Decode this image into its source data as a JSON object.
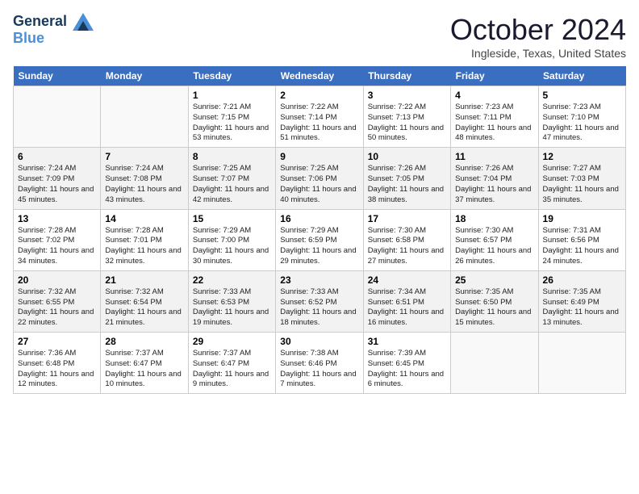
{
  "header": {
    "logo_line1": "General",
    "logo_line2": "Blue",
    "month": "October 2024",
    "location": "Ingleside, Texas, United States"
  },
  "days": [
    "Sunday",
    "Monday",
    "Tuesday",
    "Wednesday",
    "Thursday",
    "Friday",
    "Saturday"
  ],
  "weeks": [
    [
      {
        "date": "",
        "sunrise": "",
        "sunset": "",
        "daylight": ""
      },
      {
        "date": "",
        "sunrise": "",
        "sunset": "",
        "daylight": ""
      },
      {
        "date": "1",
        "sunrise": "Sunrise: 7:21 AM",
        "sunset": "Sunset: 7:15 PM",
        "daylight": "Daylight: 11 hours and 53 minutes."
      },
      {
        "date": "2",
        "sunrise": "Sunrise: 7:22 AM",
        "sunset": "Sunset: 7:14 PM",
        "daylight": "Daylight: 11 hours and 51 minutes."
      },
      {
        "date": "3",
        "sunrise": "Sunrise: 7:22 AM",
        "sunset": "Sunset: 7:13 PM",
        "daylight": "Daylight: 11 hours and 50 minutes."
      },
      {
        "date": "4",
        "sunrise": "Sunrise: 7:23 AM",
        "sunset": "Sunset: 7:11 PM",
        "daylight": "Daylight: 11 hours and 48 minutes."
      },
      {
        "date": "5",
        "sunrise": "Sunrise: 7:23 AM",
        "sunset": "Sunset: 7:10 PM",
        "daylight": "Daylight: 11 hours and 47 minutes."
      }
    ],
    [
      {
        "date": "6",
        "sunrise": "Sunrise: 7:24 AM",
        "sunset": "Sunset: 7:09 PM",
        "daylight": "Daylight: 11 hours and 45 minutes."
      },
      {
        "date": "7",
        "sunrise": "Sunrise: 7:24 AM",
        "sunset": "Sunset: 7:08 PM",
        "daylight": "Daylight: 11 hours and 43 minutes."
      },
      {
        "date": "8",
        "sunrise": "Sunrise: 7:25 AM",
        "sunset": "Sunset: 7:07 PM",
        "daylight": "Daylight: 11 hours and 42 minutes."
      },
      {
        "date": "9",
        "sunrise": "Sunrise: 7:25 AM",
        "sunset": "Sunset: 7:06 PM",
        "daylight": "Daylight: 11 hours and 40 minutes."
      },
      {
        "date": "10",
        "sunrise": "Sunrise: 7:26 AM",
        "sunset": "Sunset: 7:05 PM",
        "daylight": "Daylight: 11 hours and 38 minutes."
      },
      {
        "date": "11",
        "sunrise": "Sunrise: 7:26 AM",
        "sunset": "Sunset: 7:04 PM",
        "daylight": "Daylight: 11 hours and 37 minutes."
      },
      {
        "date": "12",
        "sunrise": "Sunrise: 7:27 AM",
        "sunset": "Sunset: 7:03 PM",
        "daylight": "Daylight: 11 hours and 35 minutes."
      }
    ],
    [
      {
        "date": "13",
        "sunrise": "Sunrise: 7:28 AM",
        "sunset": "Sunset: 7:02 PM",
        "daylight": "Daylight: 11 hours and 34 minutes."
      },
      {
        "date": "14",
        "sunrise": "Sunrise: 7:28 AM",
        "sunset": "Sunset: 7:01 PM",
        "daylight": "Daylight: 11 hours and 32 minutes."
      },
      {
        "date": "15",
        "sunrise": "Sunrise: 7:29 AM",
        "sunset": "Sunset: 7:00 PM",
        "daylight": "Daylight: 11 hours and 30 minutes."
      },
      {
        "date": "16",
        "sunrise": "Sunrise: 7:29 AM",
        "sunset": "Sunset: 6:59 PM",
        "daylight": "Daylight: 11 hours and 29 minutes."
      },
      {
        "date": "17",
        "sunrise": "Sunrise: 7:30 AM",
        "sunset": "Sunset: 6:58 PM",
        "daylight": "Daylight: 11 hours and 27 minutes."
      },
      {
        "date": "18",
        "sunrise": "Sunrise: 7:30 AM",
        "sunset": "Sunset: 6:57 PM",
        "daylight": "Daylight: 11 hours and 26 minutes."
      },
      {
        "date": "19",
        "sunrise": "Sunrise: 7:31 AM",
        "sunset": "Sunset: 6:56 PM",
        "daylight": "Daylight: 11 hours and 24 minutes."
      }
    ],
    [
      {
        "date": "20",
        "sunrise": "Sunrise: 7:32 AM",
        "sunset": "Sunset: 6:55 PM",
        "daylight": "Daylight: 11 hours and 22 minutes."
      },
      {
        "date": "21",
        "sunrise": "Sunrise: 7:32 AM",
        "sunset": "Sunset: 6:54 PM",
        "daylight": "Daylight: 11 hours and 21 minutes."
      },
      {
        "date": "22",
        "sunrise": "Sunrise: 7:33 AM",
        "sunset": "Sunset: 6:53 PM",
        "daylight": "Daylight: 11 hours and 19 minutes."
      },
      {
        "date": "23",
        "sunrise": "Sunrise: 7:33 AM",
        "sunset": "Sunset: 6:52 PM",
        "daylight": "Daylight: 11 hours and 18 minutes."
      },
      {
        "date": "24",
        "sunrise": "Sunrise: 7:34 AM",
        "sunset": "Sunset: 6:51 PM",
        "daylight": "Daylight: 11 hours and 16 minutes."
      },
      {
        "date": "25",
        "sunrise": "Sunrise: 7:35 AM",
        "sunset": "Sunset: 6:50 PM",
        "daylight": "Daylight: 11 hours and 15 minutes."
      },
      {
        "date": "26",
        "sunrise": "Sunrise: 7:35 AM",
        "sunset": "Sunset: 6:49 PM",
        "daylight": "Daylight: 11 hours and 13 minutes."
      }
    ],
    [
      {
        "date": "27",
        "sunrise": "Sunrise: 7:36 AM",
        "sunset": "Sunset: 6:48 PM",
        "daylight": "Daylight: 11 hours and 12 minutes."
      },
      {
        "date": "28",
        "sunrise": "Sunrise: 7:37 AM",
        "sunset": "Sunset: 6:47 PM",
        "daylight": "Daylight: 11 hours and 10 minutes."
      },
      {
        "date": "29",
        "sunrise": "Sunrise: 7:37 AM",
        "sunset": "Sunset: 6:47 PM",
        "daylight": "Daylight: 11 hours and 9 minutes."
      },
      {
        "date": "30",
        "sunrise": "Sunrise: 7:38 AM",
        "sunset": "Sunset: 6:46 PM",
        "daylight": "Daylight: 11 hours and 7 minutes."
      },
      {
        "date": "31",
        "sunrise": "Sunrise: 7:39 AM",
        "sunset": "Sunset: 6:45 PM",
        "daylight": "Daylight: 11 hours and 6 minutes."
      },
      {
        "date": "",
        "sunrise": "",
        "sunset": "",
        "daylight": ""
      },
      {
        "date": "",
        "sunrise": "",
        "sunset": "",
        "daylight": ""
      }
    ]
  ]
}
